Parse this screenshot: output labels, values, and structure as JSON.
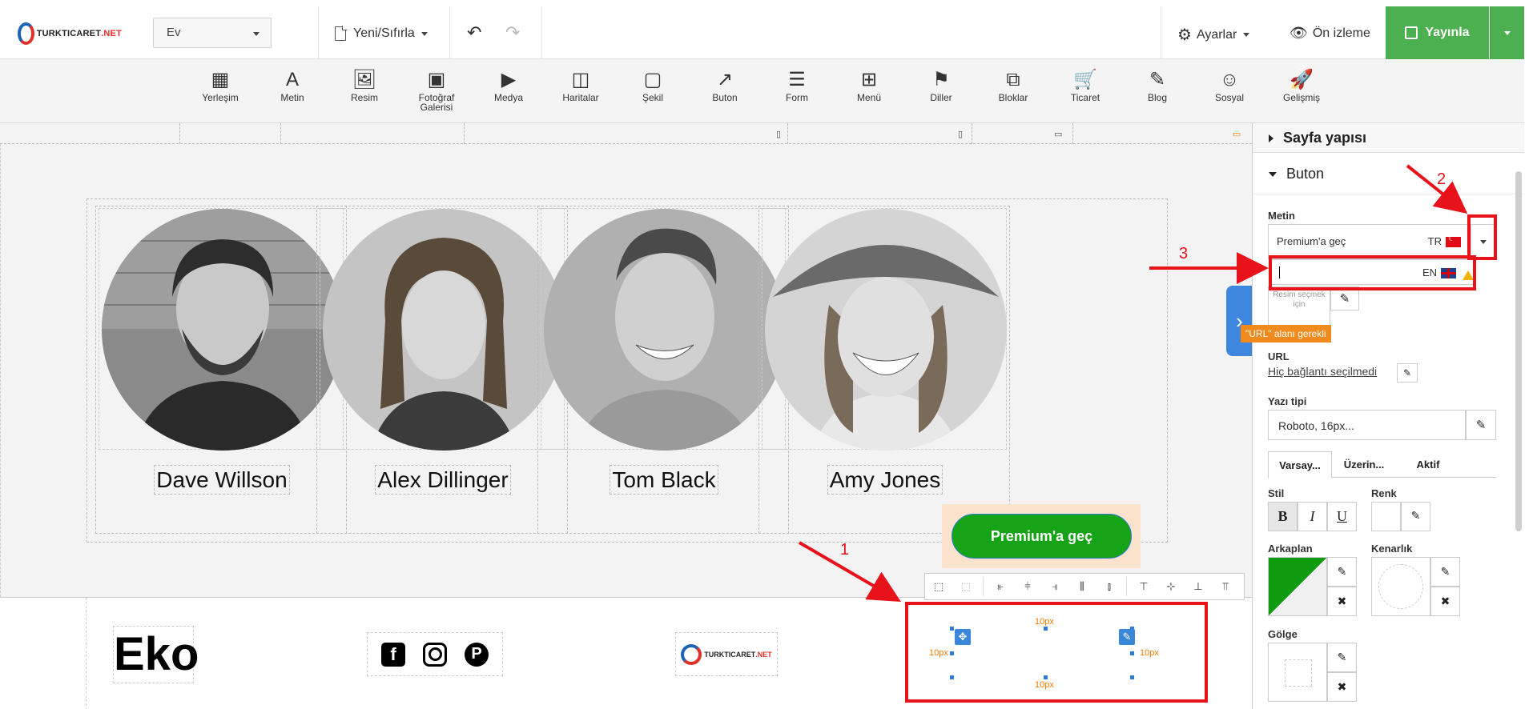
{
  "app": {
    "logo": {
      "text_main": "TURKTICARET",
      "text_accent": ".NET"
    }
  },
  "header": {
    "page_select": "Ev",
    "new_reset": "Yeni/Sıfırla",
    "undo_icon": "undo-icon",
    "redo_icon": "redo-icon",
    "settings": "Ayarlar",
    "preview": "Ön izleme",
    "publish": "Yayınla"
  },
  "toolbar": {
    "items": [
      {
        "label": "Yerleşim",
        "icon": "▦"
      },
      {
        "label": "Metin",
        "icon": "A"
      },
      {
        "label": "Resim",
        "icon": "🖼"
      },
      {
        "label": "Fotoğraf",
        "label2": "Galerisi",
        "icon": "▣"
      },
      {
        "label": "Medya",
        "icon": "▶"
      },
      {
        "label": "Haritalar",
        "icon": "◫"
      },
      {
        "label": "Şekil",
        "icon": "▢"
      },
      {
        "label": "Buton",
        "icon": "↗"
      },
      {
        "label": "Form",
        "icon": "☰"
      },
      {
        "label": "Menü",
        "icon": "⊞"
      },
      {
        "label": "Diller",
        "icon": "⚑"
      },
      {
        "label": "Bloklar",
        "icon": "⧉"
      },
      {
        "label": "Ticaret",
        "icon": "🛒"
      },
      {
        "label": "Blog",
        "icon": "✎"
      },
      {
        "label": "Sosyal",
        "icon": "☺"
      },
      {
        "label": "Gelişmiş",
        "icon": "🚀"
      }
    ]
  },
  "team": {
    "members": [
      {
        "name": "Dave Willson"
      },
      {
        "name": "Alex Dillinger"
      },
      {
        "name": "Tom Black"
      },
      {
        "name": "Amy Jones"
      }
    ]
  },
  "footer": {
    "brand": "Eko",
    "logo_main": "TURKTICARET",
    "logo_accent": ".NET",
    "button_label": "Premium'a geç",
    "padding_label": "10px"
  },
  "panel": {
    "page_structure": "Sayfa yapısı",
    "section": "Buton",
    "text_label": "Metin",
    "text_tr_value": "Premium'a geç",
    "text_tr_lang": "TR",
    "text_en_value": "",
    "text_en_lang": "EN",
    "image_hint": "Resim seçmek için",
    "url_warning": "\"URL\" alanı gerekli",
    "url_label": "URL",
    "url_value": "Hiç bağlantı seçilmedi",
    "font_label": "Yazı tipi",
    "font_value": "Roboto, 16px...",
    "tabs": [
      "Varsay...",
      "Üzerin...",
      "Aktif"
    ],
    "style_label": "Stil",
    "color_label": "Renk",
    "bg_label": "Arkaplan",
    "border_label": "Kenarlık",
    "shadow_label": "Gölge"
  },
  "annotations": {
    "n1": "1",
    "n2": "2",
    "n3": "3",
    "color": "#e8121b"
  }
}
